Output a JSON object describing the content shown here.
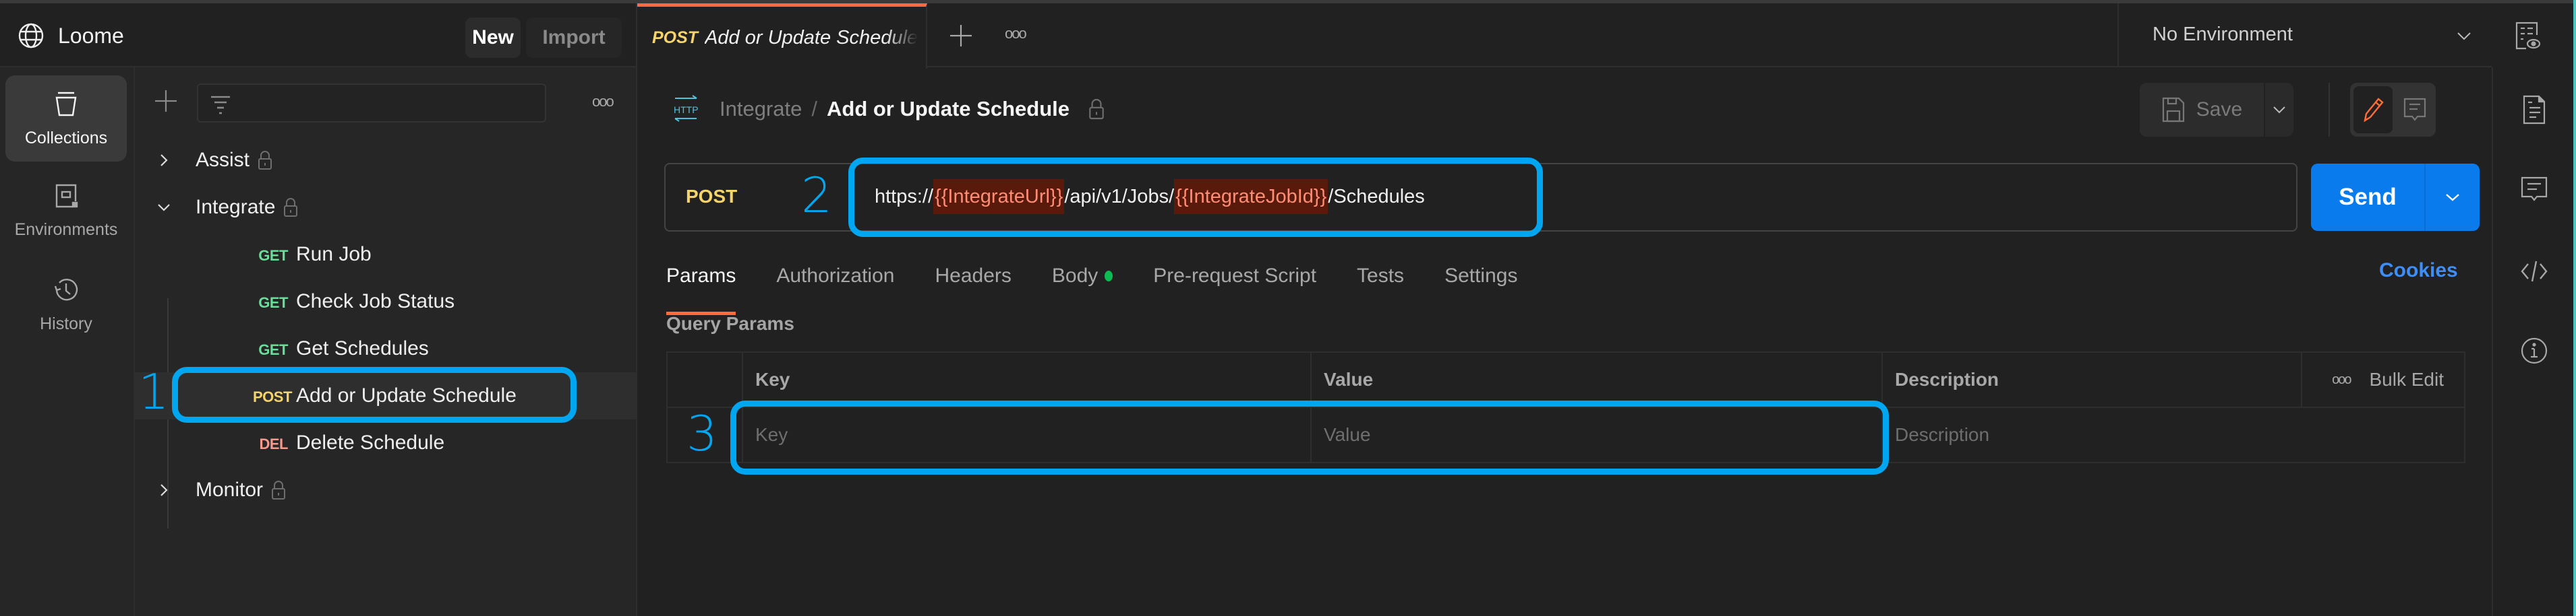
{
  "app": {
    "workspace_title": "Loome",
    "new_button": "New",
    "import_button": "Import"
  },
  "left_nav": {
    "items": [
      {
        "label": "Collections",
        "icon": "collections-icon",
        "active": true
      },
      {
        "label": "Environments",
        "icon": "environments-icon",
        "active": false
      },
      {
        "label": "History",
        "icon": "history-icon",
        "active": false
      }
    ]
  },
  "tree": {
    "more_label": "ooo",
    "folders": [
      {
        "name": "Assist",
        "expanded": false,
        "locked": true
      },
      {
        "name": "Integrate",
        "expanded": true,
        "locked": true,
        "requests": [
          {
            "method": "GET",
            "name": "Run Job"
          },
          {
            "method": "GET",
            "name": "Check Job Status"
          },
          {
            "method": "GET",
            "name": "Get Schedules"
          },
          {
            "method": "POST",
            "name": "Add or Update Schedule",
            "selected": true
          },
          {
            "method": "DEL",
            "name": "Delete Schedule"
          }
        ]
      },
      {
        "name": "Monitor",
        "expanded": false,
        "locked": true
      }
    ]
  },
  "tabs": {
    "open": [
      {
        "method": "POST",
        "title": "Add or Update Schedule",
        "active": true
      }
    ],
    "more_label": "ooo"
  },
  "environment": {
    "selected": "No Environment"
  },
  "breadcrumb": {
    "icon_label": "HTTP",
    "parent": "Integrate",
    "separator": "/",
    "current": "Add or Update Schedule"
  },
  "toolbar": {
    "save_label": "Save"
  },
  "request": {
    "method": "POST",
    "url_parts": [
      {
        "text": "https://",
        "var": false
      },
      {
        "text": "{{IntegrateUrl}}",
        "var": true
      },
      {
        "text": "/api/v1/Jobs/",
        "var": false
      },
      {
        "text": "{{IntegrateJobId}}",
        "var": true
      },
      {
        "text": "/Schedules",
        "var": false
      }
    ],
    "send_label": "Send"
  },
  "request_tabs": [
    {
      "label": "Params",
      "active": true
    },
    {
      "label": "Authorization"
    },
    {
      "label": "Headers"
    },
    {
      "label": "Body",
      "indicator": true
    },
    {
      "label": "Pre-request Script"
    },
    {
      "label": "Tests"
    },
    {
      "label": "Settings"
    }
  ],
  "cookies_label": "Cookies",
  "query_params": {
    "title": "Query Params",
    "columns": [
      "Key",
      "Value",
      "Description"
    ],
    "bulk_more": "ooo",
    "bulk_edit": "Bulk Edit",
    "placeholders": {
      "key": "Key",
      "value": "Value",
      "description": "Description"
    }
  },
  "annotations": [
    {
      "number": "1",
      "target": "sidebar-request-add-or-update-schedule"
    },
    {
      "number": "2",
      "target": "url-input"
    },
    {
      "number": "3",
      "target": "query-param-key-value-row"
    }
  ],
  "colors": {
    "accent_orange": "#ff6c37",
    "send_blue": "#097bed",
    "annotation_blue": "#00a6ef",
    "get_green": "#6bdd9a",
    "post_yellow": "#f4d46b",
    "del_red": "#f79a8e",
    "variable_text": "#ff8d76",
    "variable_bg": "#5a1a0b"
  }
}
